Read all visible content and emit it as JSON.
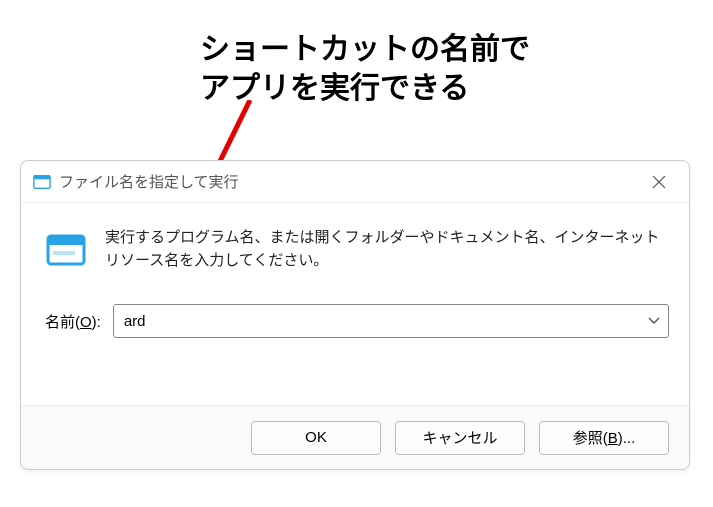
{
  "annotation": {
    "line1": "ショートカットの名前で",
    "line2": "アプリを実行できる"
  },
  "dialog": {
    "title": "ファイル名を指定して実行",
    "description": "実行するプログラム名、または開くフォルダーやドキュメント名、インターネット リソース名を入力してください。",
    "input_label_prefix": "名前(",
    "input_label_key": "O",
    "input_label_suffix": "):",
    "input_value": "ard",
    "buttons": {
      "ok": "OK",
      "cancel": "キャンセル",
      "browse_prefix": "参照(",
      "browse_key": "B",
      "browse_suffix": ")..."
    }
  },
  "colors": {
    "arrow": "#e60000",
    "icon_blue": "#29a3e6"
  }
}
